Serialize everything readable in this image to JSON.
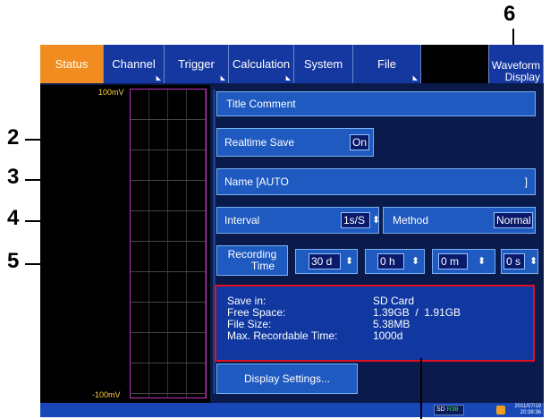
{
  "callouts": {
    "c2": "2",
    "c3": "3",
    "c4": "4",
    "c5": "5",
    "c6": "6"
  },
  "tabs": [
    {
      "label": "Status"
    },
    {
      "label": "Channel"
    },
    {
      "label": "Trigger"
    },
    {
      "label": "Calculation"
    },
    {
      "label": "System"
    },
    {
      "label": "File"
    }
  ],
  "waveform_display_tab": {
    "line1": "Waveform",
    "line2": "Display"
  },
  "waveform": {
    "top_label": "100mV",
    "bottom_label": "-100mV"
  },
  "title_comment": "Title Comment",
  "realtime_save": {
    "label": "Realtime Save",
    "value": "On"
  },
  "name": {
    "label": "Name [AUTO",
    "end": "]"
  },
  "interval": {
    "label": "Interval",
    "value": "1s/S",
    "arrow": "⬍"
  },
  "method": {
    "label": "Method",
    "value": "Normal"
  },
  "recording_time": {
    "label_line1": "Recording",
    "label_line2": "Time",
    "days": "30 d",
    "hours": "0 h",
    "minutes": "0 m",
    "seconds": "0 s",
    "spin": "⬍"
  },
  "save_info": {
    "save_in_label": "Save in:",
    "save_in_value": "SD Card",
    "free_space_label": "Free Space:",
    "free_space_value": "1.39GB  /  1.91GB",
    "file_size_label": "File Size:",
    "file_size_value": "5.38MB",
    "max_time_label": "Max. Recordable Time:",
    "max_time_value": "1000d"
  },
  "display_settings": "Display Settings...",
  "statusbar": {
    "sd_label": "SD",
    "sd_pct": "R38",
    "date": "2011/07/19",
    "time": "20:38:36"
  },
  "colors": {
    "accent": "#f08c20",
    "highlight_box": "#e01020",
    "panel": "#1e5ac0",
    "background": "#0a1a4a"
  }
}
